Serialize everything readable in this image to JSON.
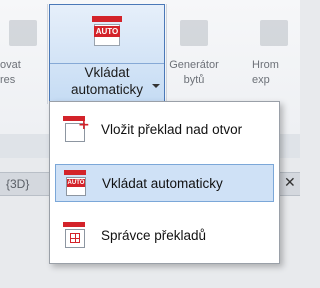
{
  "ribbon": {
    "left_button_label": "ovat\nres",
    "active_button": {
      "label_line1": "Vkládat",
      "label_line2": "automaticky",
      "icon_text": "AUTO"
    },
    "right_button_1_label": "Generátor\nbytů",
    "right_button_2_label": "Hrom\nexp"
  },
  "view_tab": "{3D}",
  "close_glyph": "✕",
  "menu": {
    "items": [
      {
        "label": "Vložit překlad nad otvor",
        "icon": "lintel-plus-icon",
        "selected": false
      },
      {
        "label": "Vkládat automaticky",
        "icon": "lintel-auto-icon",
        "selected": true,
        "icon_text": "AUTO"
      },
      {
        "label": "Správce překladů",
        "icon": "lintel-manager-icon",
        "selected": false
      }
    ]
  },
  "colors": {
    "accent_red": "#d3232a",
    "selection_blue": "#cfe1f6",
    "selection_border": "#7ba7d8"
  }
}
